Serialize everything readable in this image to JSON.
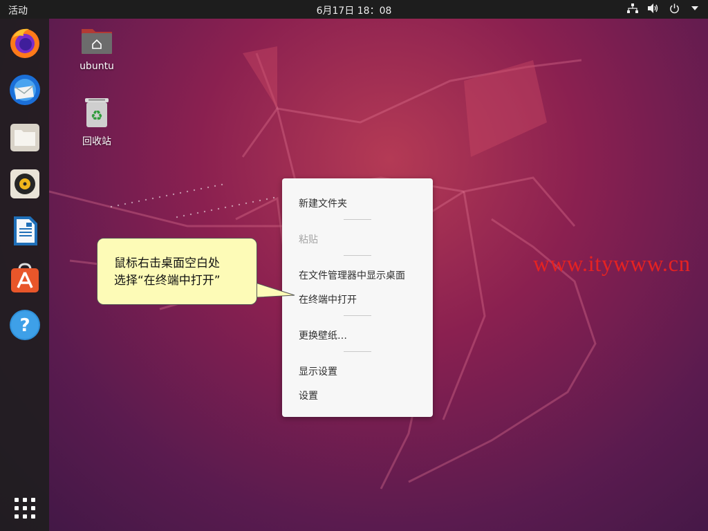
{
  "topbar": {
    "activities_label": "活动",
    "clock": "6月17日  18：08",
    "icons": [
      "network-icon",
      "volume-icon",
      "power-icon",
      "menu-arrow-icon"
    ]
  },
  "dock": {
    "items": [
      "firefox-icon",
      "thunderbird-icon",
      "files-icon",
      "rhythmbox-icon",
      "writer-icon",
      "software-icon",
      "help-icon"
    ],
    "apps_grid": "show-apps-icon"
  },
  "desktop": {
    "home_label": "ubuntu",
    "trash_label": "回收站"
  },
  "context_menu": {
    "items": [
      {
        "label": "新建文件夹",
        "enabled": true
      },
      {
        "label": "粘贴",
        "enabled": false
      },
      {
        "label": "在文件管理器中显示桌面",
        "enabled": true
      },
      {
        "label": "在终端中打开",
        "enabled": true
      },
      {
        "label": "更换壁纸…",
        "enabled": true
      },
      {
        "label": "显示设置",
        "enabled": true
      },
      {
        "label": "设置",
        "enabled": true
      }
    ]
  },
  "callout": {
    "line1": "鼠标右击桌面空白处",
    "line2": "选择“在终端中打开”"
  },
  "watermark": "www.itywww.cn",
  "colors": {
    "topbar": "#1d1d1d",
    "menu_bg": "#f7f7f7",
    "callout_bg": "#fdfbb7",
    "watermark": "#e52222"
  }
}
